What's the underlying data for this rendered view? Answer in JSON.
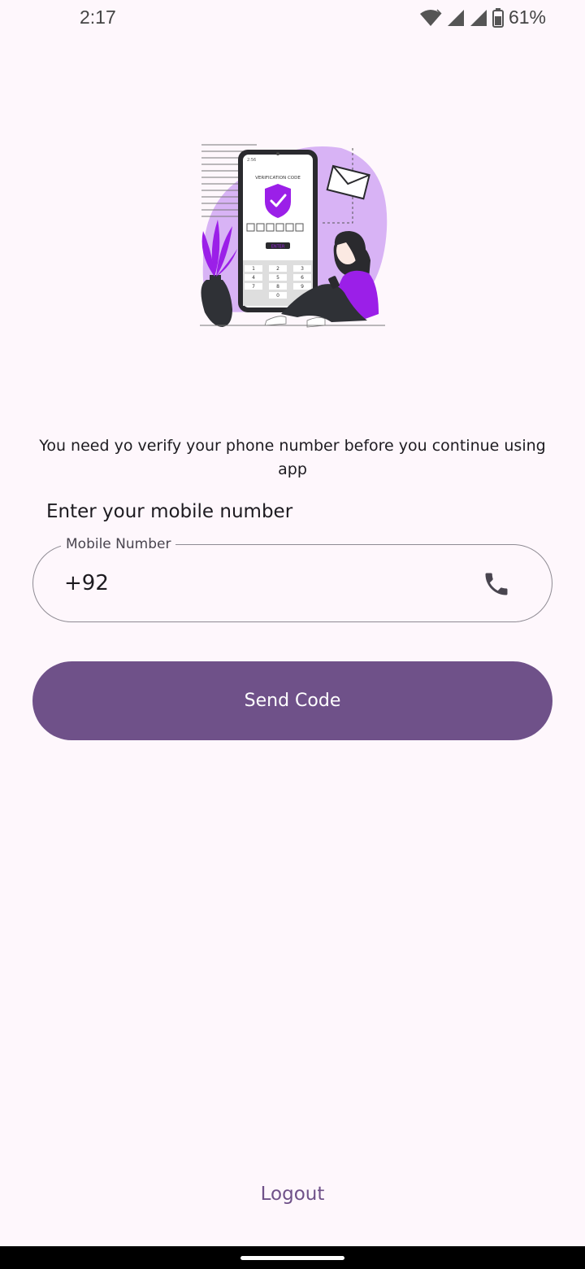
{
  "status_bar": {
    "time": "2:17",
    "battery": "61%"
  },
  "illustration": {
    "screen_title": "VERIFICATION CODE",
    "screen_time": "2:56",
    "enter_label": "ENTER",
    "keys": [
      "1",
      "2",
      "3",
      "4",
      "5",
      "6",
      "7",
      "8",
      "9",
      "0"
    ]
  },
  "main": {
    "intro_text": "You need yo verify your phone number before you continue using app",
    "field_heading": "Enter your mobile number",
    "mobile_field": {
      "label": "Mobile Number",
      "value": "+92"
    },
    "send_button": "Send Code",
    "logout": "Logout"
  },
  "colors": {
    "background": "#fef7fc",
    "primary": "#6f5189",
    "accent": "#9b1fe8"
  },
  "icons": [
    "wifi-icon",
    "signal-icon",
    "battery-icon",
    "phone-icon"
  ]
}
